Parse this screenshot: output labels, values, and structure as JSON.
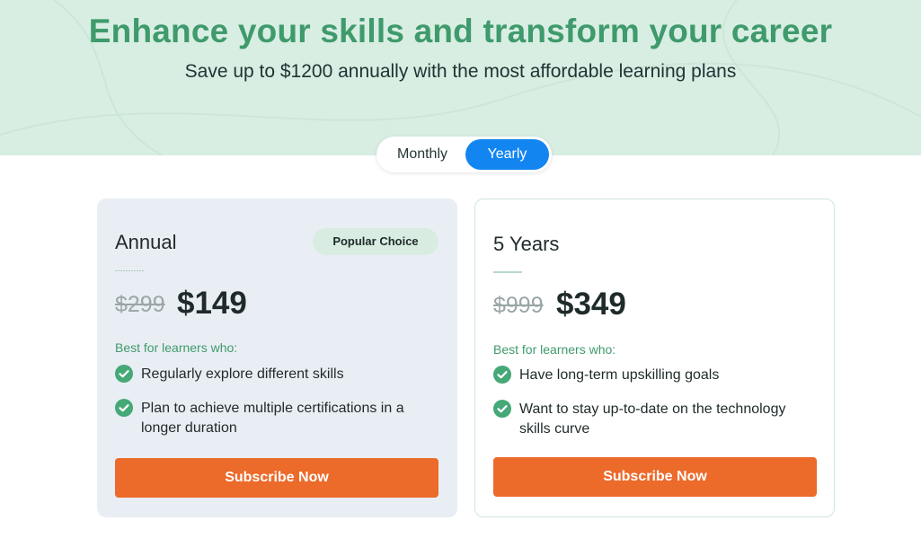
{
  "hero": {
    "title": "Enhance your skills and transform your career",
    "subtitle": "Save up to $1200 annually with the most affordable learning plans"
  },
  "billing_toggle": {
    "options": [
      "Monthly",
      "Yearly"
    ],
    "selected": "Yearly"
  },
  "plans": [
    {
      "name": "Annual",
      "badge": "Popular Choice",
      "old_price": "$299",
      "price": "$149",
      "best_for_label": "Best for learners who:",
      "features": [
        "Regularly explore different skills",
        "Plan to achieve multiple certifications in a longer duration"
      ],
      "cta": "Subscribe Now"
    },
    {
      "name": "5 Years",
      "old_price": "$999",
      "price": "$349",
      "best_for_label": "Best for learners who:",
      "features": [
        "Have long-term upskilling goals",
        "Want to stay up-to-date on the technology skills curve"
      ],
      "cta": "Subscribe Now"
    }
  ],
  "colors": {
    "hero_bg": "#d8eee3",
    "title_green": "#3f9a6c",
    "toggle_active": "#1385f0",
    "cta_orange": "#ec6a2a",
    "check_green": "#45a877"
  },
  "icons": [
    "check-circle-icon"
  ]
}
